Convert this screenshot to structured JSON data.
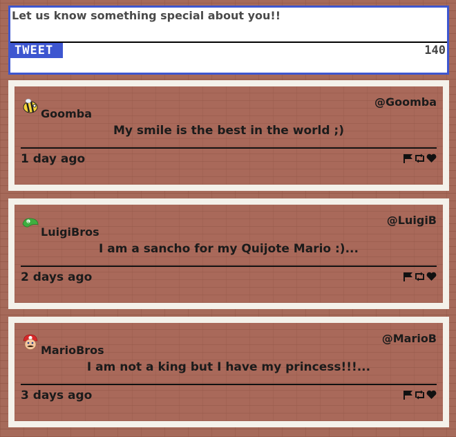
{
  "composer": {
    "text": "Let us know something special about you!!",
    "tweet_label": "TWEET",
    "char_count": "140"
  },
  "colors": {
    "accent": "#3d56d0",
    "card_bg": "#f4f1ea",
    "brick": "#a9695a"
  },
  "tweets": [
    {
      "avatar_icon": "bee-icon",
      "name": "Goomba",
      "handle": "@Goomba",
      "message": "My smile is the best in the world ;)",
      "time": "1 day ago"
    },
    {
      "avatar_icon": "green-cap-icon",
      "name": "LuigiBros",
      "handle": "@LuigiB",
      "message": "I am a sancho for my Quijote Mario :)...",
      "time": "2 days ago"
    },
    {
      "avatar_icon": "mario-head-icon",
      "name": "MarioBros",
      "handle": "@MarioB",
      "message": "I am not a king but I have my princess!!!...",
      "time": "3 days ago"
    }
  ]
}
